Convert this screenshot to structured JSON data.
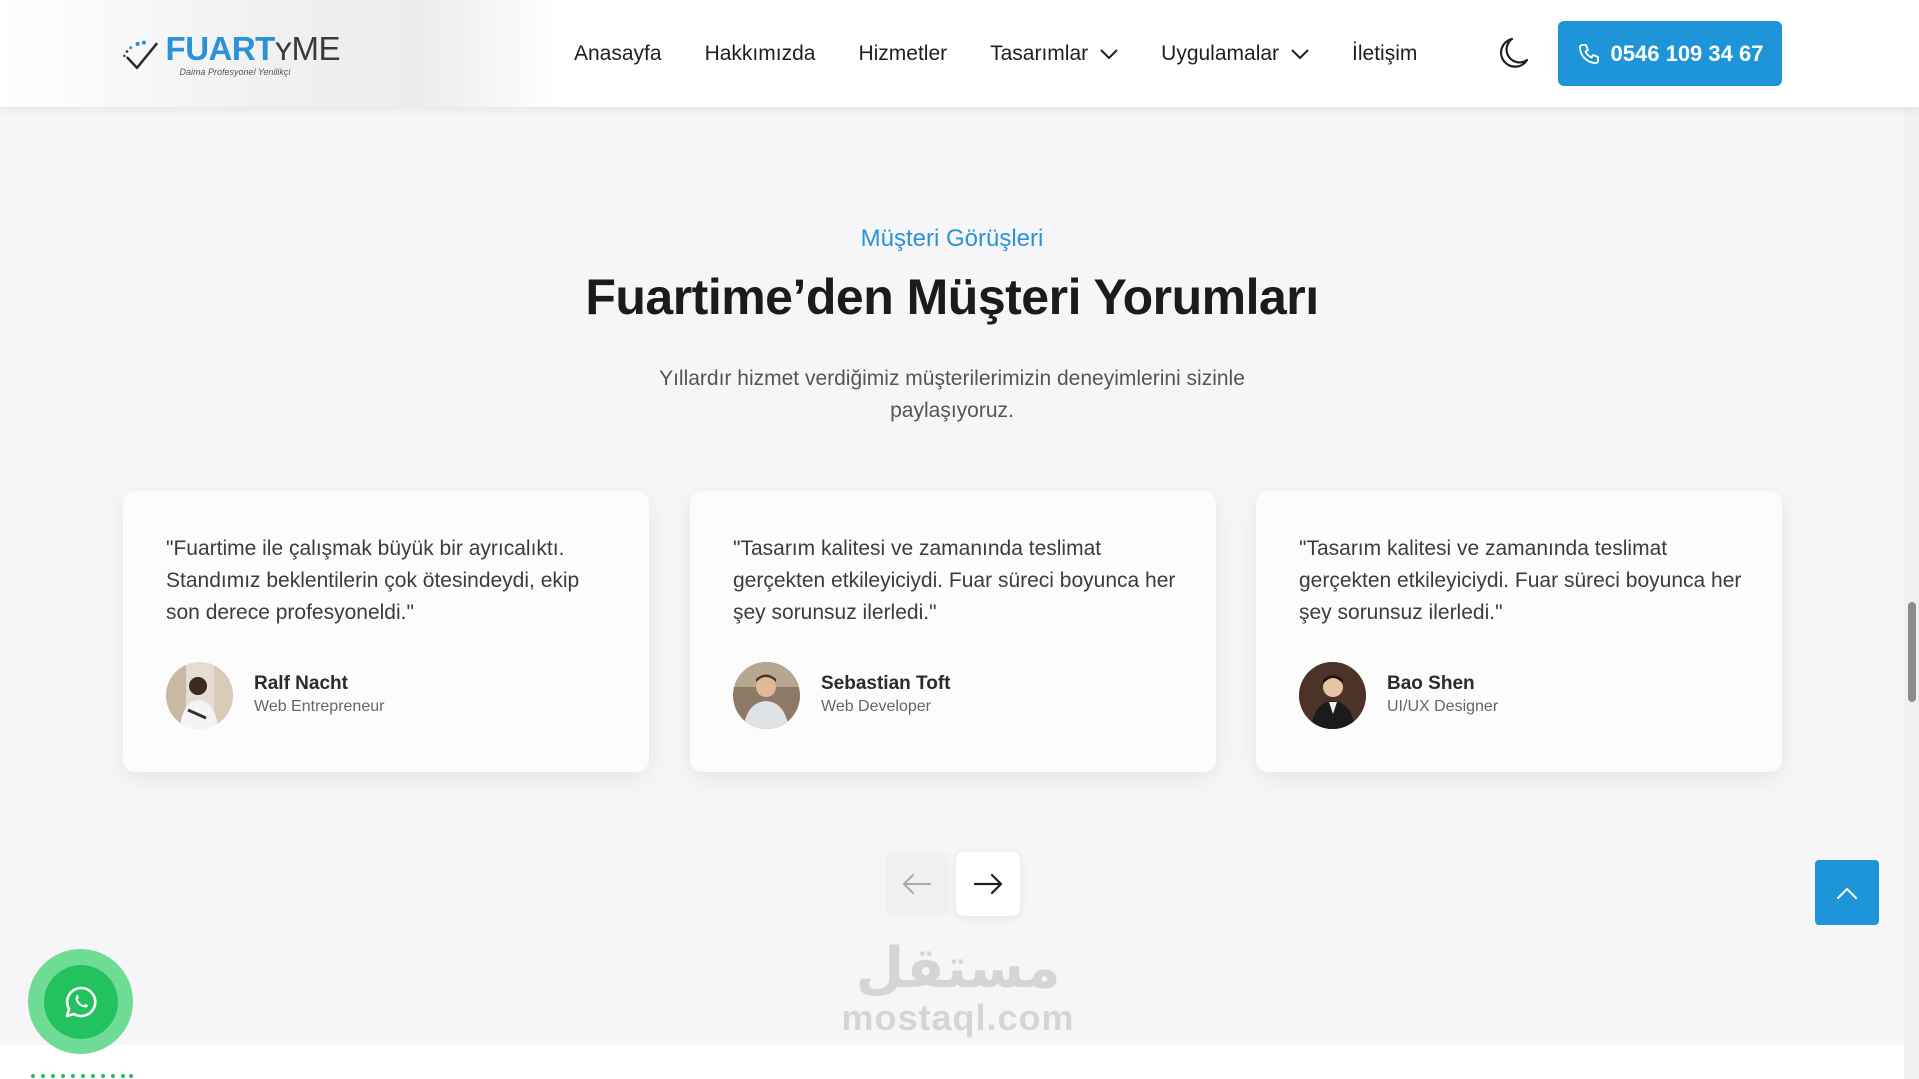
{
  "header": {
    "logo": {
      "brand_fuar": "FUART",
      "brand_time": "ME",
      "tagline": "Daima Profesyonel Yenilikçi"
    },
    "nav": [
      {
        "label": "Anasayfa",
        "dropdown": false
      },
      {
        "label": "Hakkımızda",
        "dropdown": false
      },
      {
        "label": "Hizmetler",
        "dropdown": false
      },
      {
        "label": "Tasarımlar",
        "dropdown": true
      },
      {
        "label": "Uygulamalar",
        "dropdown": true
      },
      {
        "label": "İletişim",
        "dropdown": false
      }
    ],
    "theme_toggle_icon": "moon-icon",
    "phone": {
      "icon": "phone-icon",
      "label": "0546 109 34 67"
    }
  },
  "section": {
    "eyebrow": "Müşteri Görüşleri",
    "title": "Fuartime’den Müşteri Yorumları",
    "subtitle": "Yıllardır hizmet verdiğimiz müşterilerimizin deneyimlerini sizinle paylaşıyoruz."
  },
  "testimonials": [
    {
      "quote": "\"Fuartime ile çalışmak büyük bir ayrıcalıktı. Standımız beklentilerin çok ötesindeydi, ekip son derece profesyoneldi.\"",
      "name": "Ralf Nacht",
      "role": "Web Entrepreneur"
    },
    {
      "quote": "\"Tasarım kalitesi ve zamanında teslimat gerçekten etkileyiciydi. Fuar süreci boyunca her şey sorunsuz ilerledi.\"",
      "name": "Sebastian Toft",
      "role": "Web Developer"
    },
    {
      "quote": "\"Tasarım kalitesi ve zamanında teslimat gerçekten etkileyiciydi. Fuar süreci boyunca her şey sorunsuz ilerledi.\"",
      "name": "Bao Shen",
      "role": "UI/UX Designer"
    }
  ],
  "carousel": {
    "prev_icon": "arrow-left-icon",
    "next_icon": "arrow-right-icon",
    "prev_enabled": false
  },
  "watermark": {
    "arabic": "مستقل",
    "latin": "mostaql.com"
  },
  "floating": {
    "whatsapp_icon": "whatsapp-icon",
    "scroll_top_icon": "chevron-up-icon"
  },
  "colors": {
    "accent": "#1e94d9",
    "whatsapp": "#22c35e",
    "background": "#f6f6f8"
  }
}
